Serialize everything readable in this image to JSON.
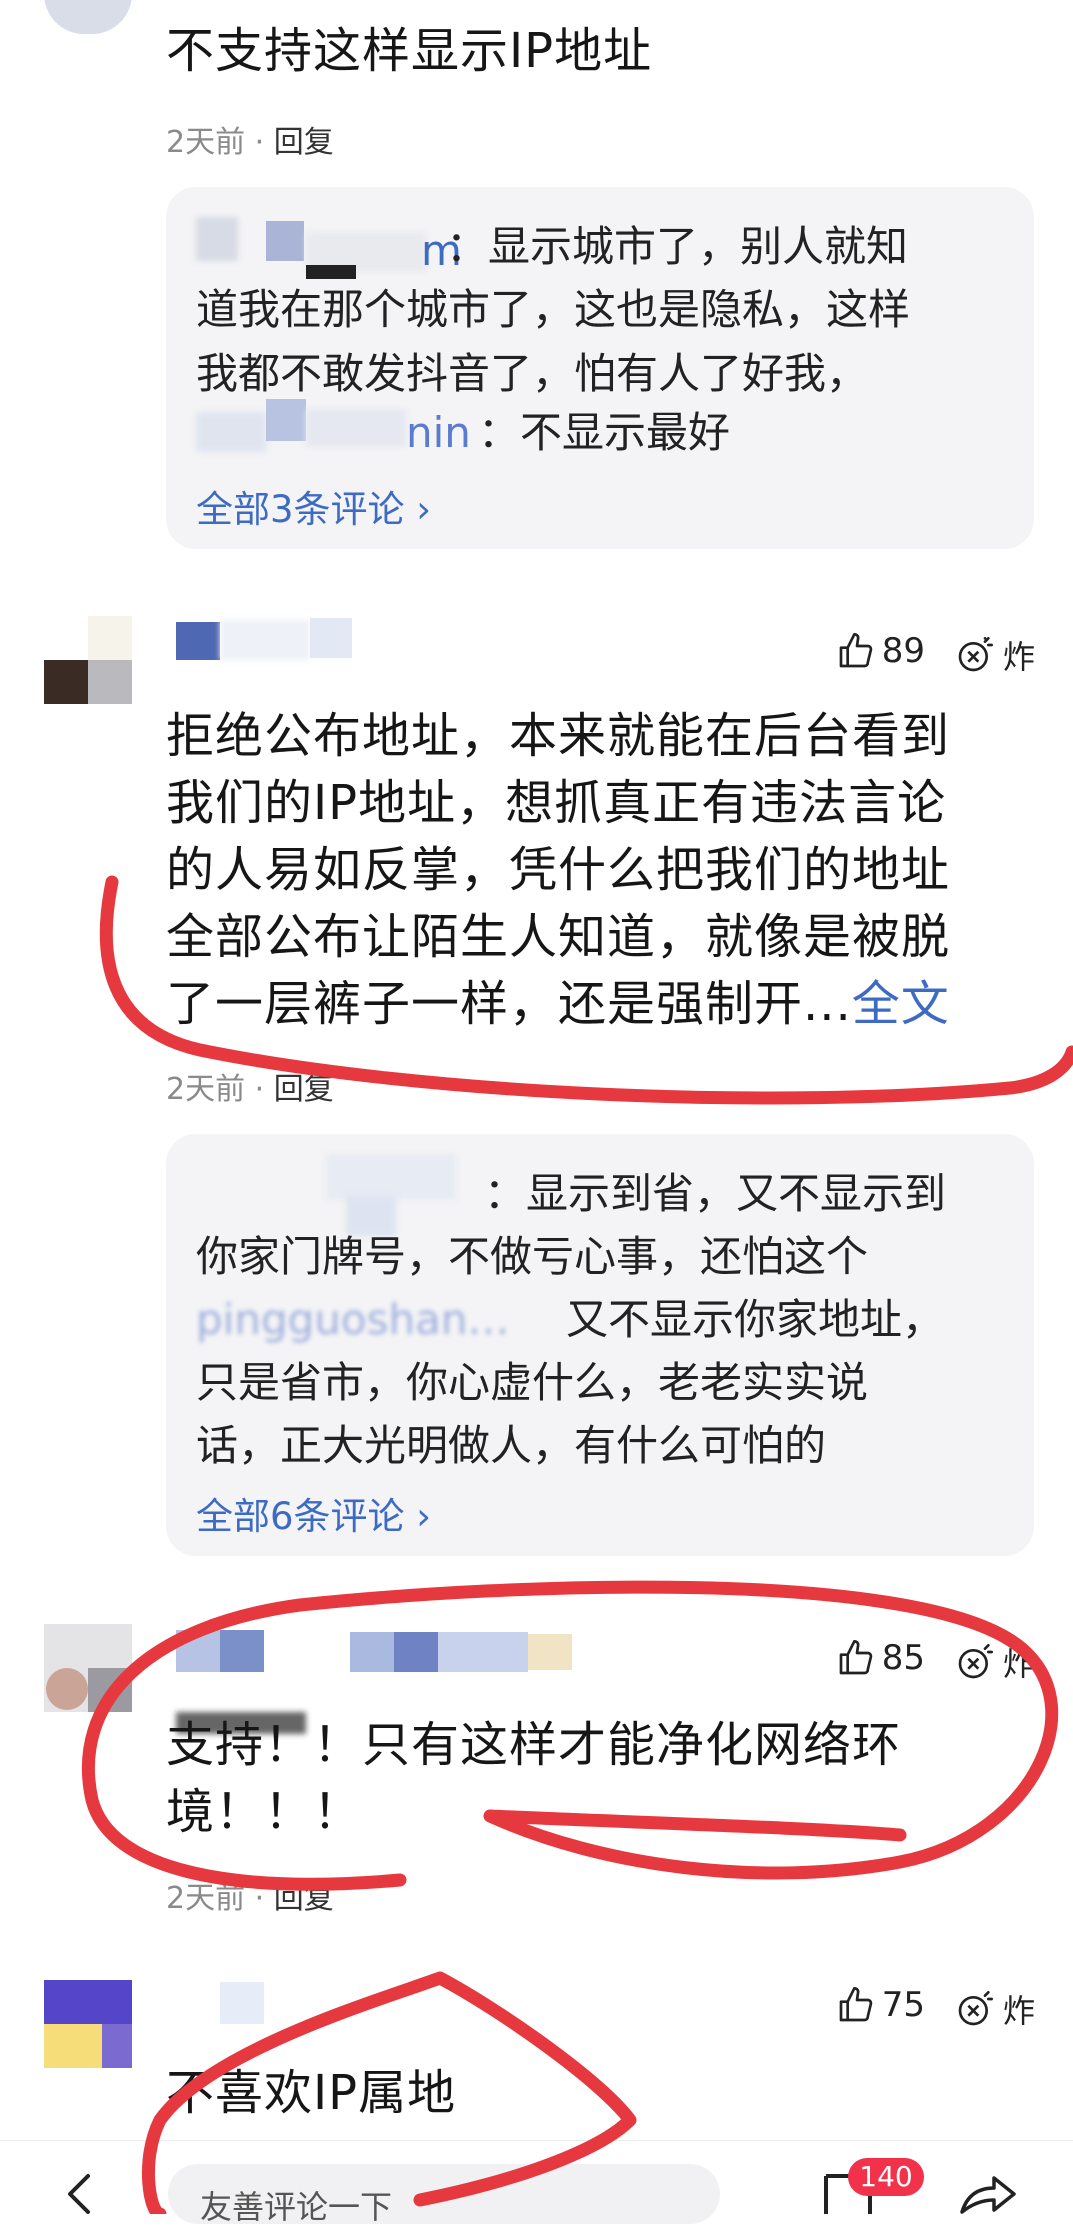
{
  "comments": [
    {
      "text_lines": [
        "不支持这样显示IP地址"
      ],
      "time": "2天前",
      "reply_label": "回复",
      "replies": [
        {
          "author": "m",
          "lines": [
            "：显示城市了，别人就知",
            "道我在那个城市了，这也是隐私，这样",
            "我都不敢发抖音了，怕有人了好我，"
          ]
        },
        {
          "author": "nin",
          "lines": [
            "：不显示最好"
          ]
        }
      ],
      "more_label": "全部3条评论"
    },
    {
      "likes": "89",
      "zha_label": "炸",
      "text_lines": [
        "拒绝公布地址，本来就能在后台看到",
        "我们的IP地址，想抓真正有违法言论",
        "的人易如反掌，凭什么把我们的地址",
        "全部公布让陌生人知道，就像是被脱"
      ],
      "last_line": "了一层裤子一样，还是强制开...",
      "expand_label": "全文",
      "time": "2天前",
      "reply_label": "回复",
      "replies": [
        {
          "author": "",
          "lines": [
            "：显示到省，又不显示到",
            "你家门牌号，不做亏心事，还怕这个"
          ]
        },
        {
          "author": "pingguoshan…",
          "lines": [
            "又不显示你家地址，",
            "只是省市，你心虚什么，老老实实说",
            "话，正大光明做人，有什么可怕的"
          ]
        }
      ],
      "more_label": "全部6条评论"
    },
    {
      "likes": "85",
      "zha_label": "炸",
      "text_lines": [
        "支持！！只有这样才能净化网络环",
        "境！！！"
      ],
      "time": "2天前",
      "reply_label": "回复"
    },
    {
      "likes": "75",
      "zha_label": "炸",
      "text_lines": [
        "不喜欢IP属地"
      ]
    }
  ],
  "bottom_bar": {
    "input_placeholder": "友善评论一下",
    "comment_count": "140"
  },
  "colors": {
    "link": "#3d6bc3",
    "annotation_red": "#e6393f",
    "badge_red": "#f2314a",
    "reply_bg": "#f4f4f6"
  }
}
